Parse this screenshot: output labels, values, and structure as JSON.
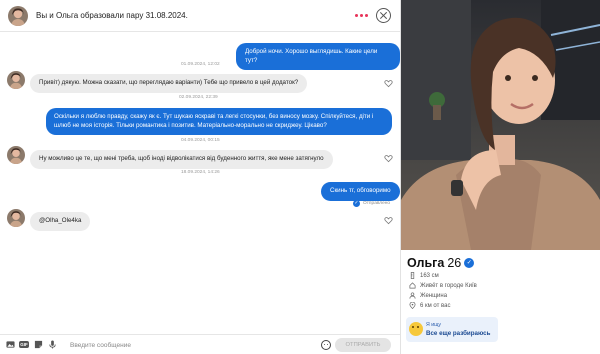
{
  "header": {
    "title": "Вы и Ольга образовали пару 31.08.2024."
  },
  "messages": [
    {
      "type": "out",
      "text": "Доброй ночи. Хорошо выглядишь. Какие цели тут?"
    },
    {
      "type": "stamp",
      "text": "01.09.2024, 12:02"
    },
    {
      "type": "in",
      "text": "Привіт) дякую. Можна сказати, що переглядаю варіанти) Тебе що привело в цей додаток?"
    },
    {
      "type": "stamp",
      "text": "02.09.2024, 22:39"
    },
    {
      "type": "out",
      "text": "Оскільки я люблю правду, скажу як є. Тут шукаю яскраві та легкі стосунки, без виносу мозку. Спілкуйтеся, діти і шлюб не моя історія. Тільки романтика і позитив. Матеріально-морально не скриджеу. Цікаво?"
    },
    {
      "type": "stamp",
      "text": "04.09.2024, 00:15"
    },
    {
      "type": "in",
      "text": "Ну можливо це те, що мені треба, щоб іноді відволікатися від буденного життя, яке мене затягнуло"
    },
    {
      "type": "stamp",
      "text": "18.09.2024, 14:26"
    },
    {
      "type": "out",
      "text": "Скинь тг, обговоримо"
    },
    {
      "type": "status",
      "text": "Отправлено"
    },
    {
      "type": "in",
      "text": "@Olha_Ole4ka"
    }
  ],
  "composer": {
    "placeholder": "Введите сообщение",
    "send_label": "ОТПРАВИТЬ",
    "gif_label": "GIF"
  },
  "profile": {
    "name": "Ольга",
    "age": "26",
    "height": "163 см",
    "location": "Живёт в городе Київ",
    "gender": "Женщина",
    "distance": "6 км от вас",
    "looking_label": "Я ищу",
    "looking_value": "Все еще разбираюсь"
  },
  "colors": {
    "accent_blue": "#1a6fd8",
    "incoming_bubble": "#ececec",
    "more_dots": "#e8345a"
  }
}
